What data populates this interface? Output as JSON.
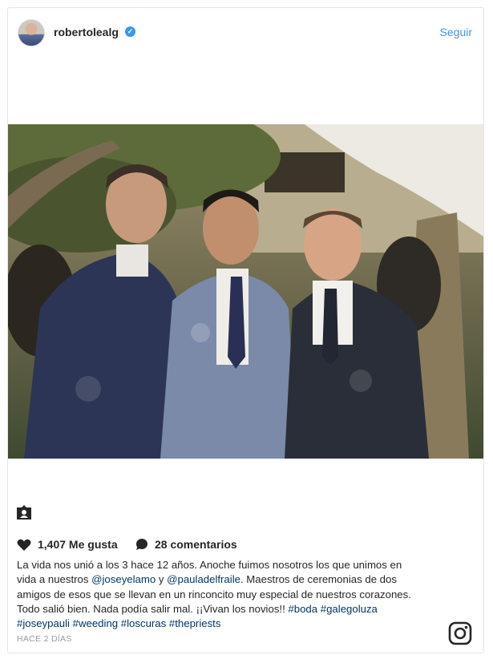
{
  "header": {
    "username": "robertolealg",
    "follow_label": "Seguir"
  },
  "stats": {
    "likes_label": "1,407 Me gusta",
    "comments_label": "28 comentarios"
  },
  "caption": {
    "line1": "La vida nos unió a los 3 hace 12 años. Anoche fuimos nosotros los que unimos en",
    "line2_a": "vida a nuestros ",
    "mention1": "@joseyelamo",
    "line2_b": " y ",
    "mention2": "@pauladelfraile",
    "line2_c": ". Maestros de ceremonias de dos",
    "line3": "amigos de esos que se llevan en un rinconcito muy especial de nuestros corazones.",
    "line4": "Todo salió bien. Nada podía salir mal. ¡¡Vivan los novios!! ",
    "hashtag1": "#boda",
    "hashtag2": "#galegoluza",
    "hashtag3": "#joseypauli",
    "hashtag4": "#weeding",
    "hashtag5": "#loscuras",
    "hashtag6": "#thepriests"
  },
  "timestamp": "HACE 2 DÍAS",
  "icons": {
    "verified": "verified-badge-icon",
    "tag": "user-tag-icon",
    "heart": "heart-icon",
    "comment": "comment-icon",
    "instagram": "instagram-logo-icon"
  },
  "colors": {
    "link": "#3897f0",
    "hashtag": "#003569",
    "muted": "#999999"
  }
}
